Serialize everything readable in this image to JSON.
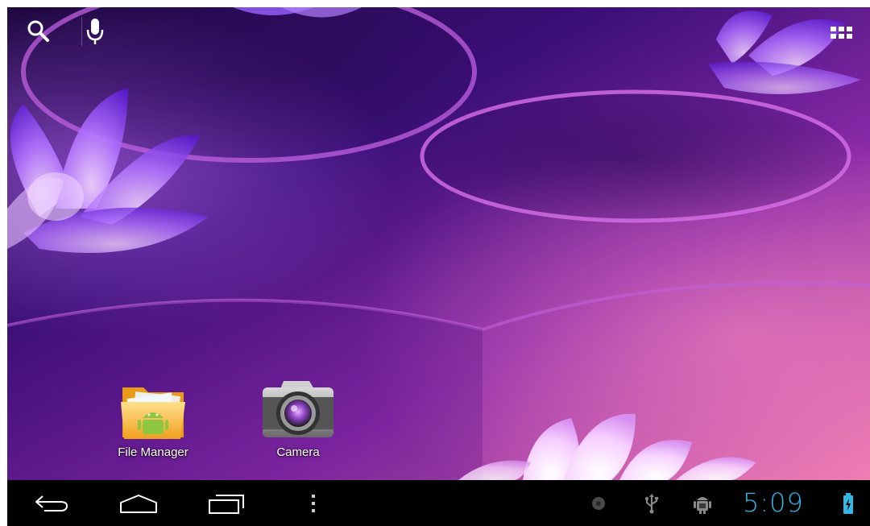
{
  "home": {
    "top_bar": {
      "search_icon": "search-icon",
      "voice_icon": "microphone-icon",
      "apps_icon": "all-apps-grid-icon"
    },
    "apps": [
      {
        "label": "File Manager",
        "icon": "folder-android-icon"
      },
      {
        "label": "Camera",
        "icon": "camera-icon"
      }
    ]
  },
  "nav_bar": {
    "buttons": [
      "back-icon",
      "home-icon",
      "recent-apps-icon",
      "menu-overflow-icon"
    ],
    "status": {
      "icons": [
        "notification-dot-icon",
        "usb-icon",
        "android-debug-icon"
      ],
      "time": "5:09",
      "battery_icon": "battery-charging-icon"
    }
  },
  "colors": {
    "accent": "#33b5e5",
    "nav_background": "#000000",
    "wallpaper_dark": "#2a0a5a",
    "wallpaper_mid": "#7a2ab0",
    "wallpaper_light": "#e86aa8"
  }
}
